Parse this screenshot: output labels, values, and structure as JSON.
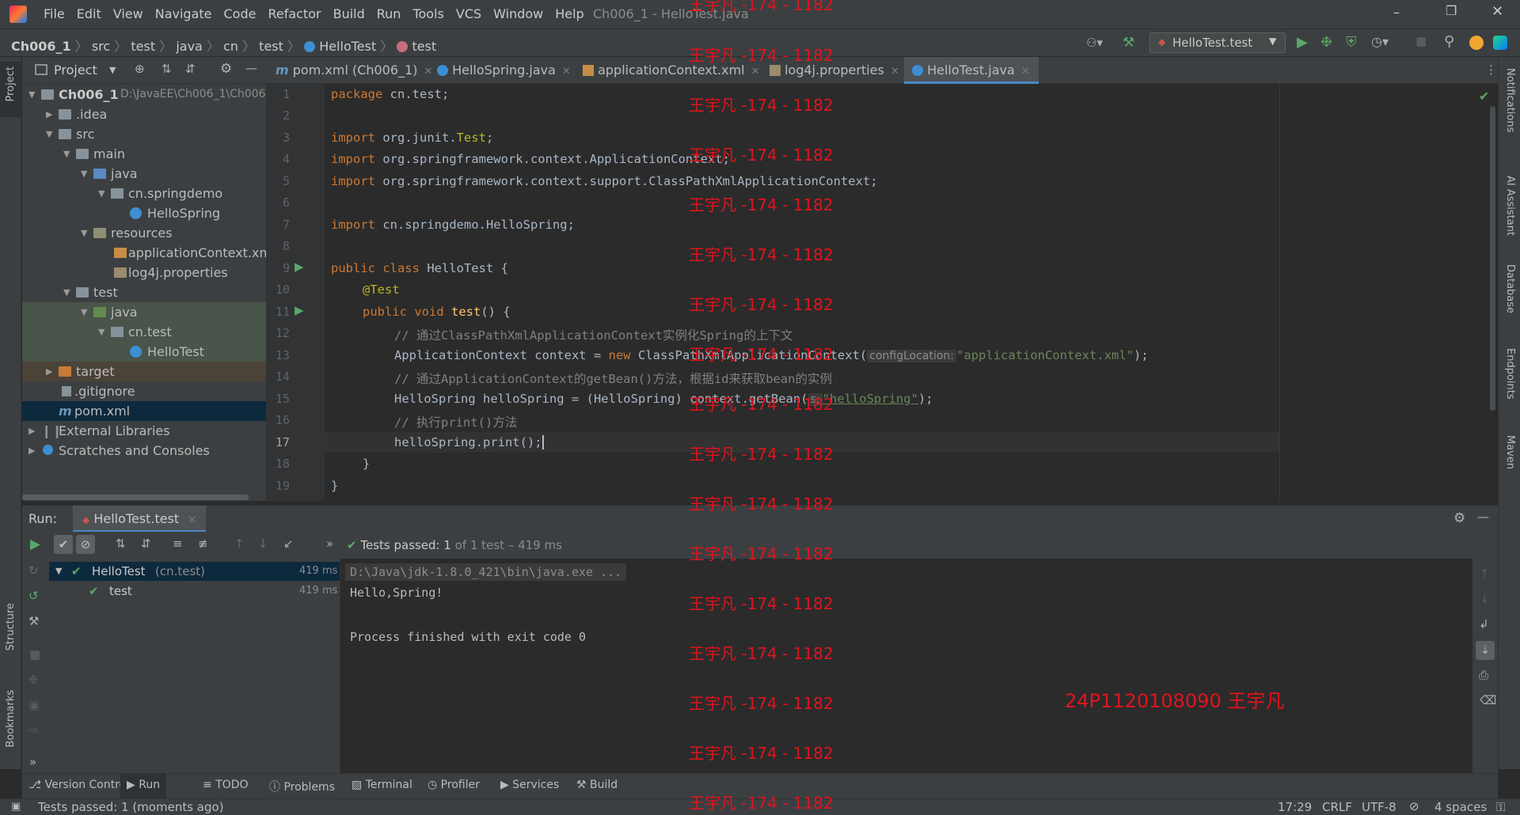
{
  "window": {
    "title": "Ch006_1 - HelloTest.java",
    "menu": [
      "File",
      "Edit",
      "View",
      "Navigate",
      "Code",
      "Refactor",
      "Build",
      "Run",
      "Tools",
      "VCS",
      "Window",
      "Help"
    ]
  },
  "breadcrumb": [
    "Ch006_1",
    "src",
    "test",
    "java",
    "cn",
    "test",
    "HelloTest",
    "test"
  ],
  "run_config": "HelloTest.test",
  "project_panel": {
    "title": "Project",
    "tree": [
      {
        "label": "Ch006_1",
        "extra": "D:\\JavaEE\\Ch006_1\\Ch006"
      },
      {
        "label": ".idea"
      },
      {
        "label": "src"
      },
      {
        "label": "main"
      },
      {
        "label": "java"
      },
      {
        "label": "cn.springdemo"
      },
      {
        "label": "HelloSpring"
      },
      {
        "label": "resources"
      },
      {
        "label": "applicationContext.xm"
      },
      {
        "label": "log4j.properties"
      },
      {
        "label": "test"
      },
      {
        "label": "java"
      },
      {
        "label": "cn.test"
      },
      {
        "label": "HelloTest"
      },
      {
        "label": "target"
      },
      {
        "label": ".gitignore"
      },
      {
        "label": "pom.xml"
      },
      {
        "label": "External Libraries"
      },
      {
        "label": "Scratches and Consoles"
      }
    ]
  },
  "editor_tabs": [
    "pom.xml (Ch006_1)",
    "HelloSpring.java",
    "applicationContext.xml",
    "log4j.properties",
    "HelloTest.java"
  ],
  "code": {
    "line_numbers": [
      "1",
      "2",
      "3",
      "4",
      "5",
      "6",
      "7",
      "8",
      "9",
      "10",
      "11",
      "12",
      "13",
      "14",
      "15",
      "16",
      "17",
      "18",
      "19"
    ],
    "l1": {
      "kw": "package",
      "rest": " cn.test;"
    },
    "l3": {
      "kw": "import",
      "rest": " org.junit.",
      "cls": "Test",
      ";": ";"
    },
    "l4": {
      "kw": "import",
      "rest": " org.springframework.context.ApplicationContext;"
    },
    "l5": {
      "kw": "import",
      "rest": " org.springframework.context.support.ClassPathXmlApplicationContext;"
    },
    "l7": {
      "kw": "import",
      "rest": " cn.springdemo.HelloSpring;"
    },
    "l9": {
      "kw": "public class",
      "rest": " HelloTest {"
    },
    "l10": {
      "ann": "@Test"
    },
    "l11": {
      "kw": "public void",
      "fn": "test",
      "rest": "() {"
    },
    "l12": {
      "cmt": "// 通过ClassPathXmlApplicationContext实例化Spring的上下文"
    },
    "l13": {
      "pre": "ApplicationContext context = ",
      "kw": "new",
      "mid": " ClassPathXmlApplicationContext(",
      "hint": "configLocation:",
      "str": "\"applicationContext.xml\"",
      "post": ");"
    },
    "l14": {
      "cmt": "// 通过ApplicationContext的getBean()方法，根据id来获取bean的实例"
    },
    "l15": {
      "pre": "HelloSpring helloSpring = (HelloSpring) context.getBean(",
      "hint": "s:",
      "str": "\"helloSpring\"",
      "post": ");"
    },
    "l16": {
      "cmt": "// 执行print()方法"
    },
    "l17": {
      "pre": "helloSpring.print();"
    },
    "l18": {
      "pre": "}"
    },
    "l19": {
      "pre": "}"
    }
  },
  "run_panel": {
    "label": "Run:",
    "tab": "HelloTest.test",
    "status": "Tests passed:",
    "status_count": "1",
    "status_detail": "of 1 test – 419 ms",
    "tree": [
      {
        "name": "HelloTest",
        "pkg": "(cn.test)",
        "time": "419 ms"
      },
      {
        "name": "test",
        "time": "419 ms"
      }
    ],
    "console": [
      "D:\\Java\\jdk-1.8.0_421\\bin\\java.exe ...",
      "Hello,Spring!",
      "",
      "Process finished with exit code 0"
    ]
  },
  "bottom_tabs": [
    "Version Control",
    "Run",
    "TODO",
    "Problems",
    "Terminal",
    "Profiler",
    "Services",
    "Build"
  ],
  "status_bar": {
    "message": "Tests passed: 1 (moments ago)",
    "position": "17:29",
    "line_sep": "CRLF",
    "encoding": "UTF-8",
    "indent": "4 spaces"
  },
  "right_stripe": [
    "Notifications",
    "AI Assistant",
    "Database",
    "Endpoints",
    "Maven"
  ],
  "left_stripe": [
    "Project",
    "Structure",
    "Bookmarks"
  ],
  "watermark": {
    "repeat": "王宇凡 -174 - 1182",
    "id": "24P1120108090 王宇凡"
  }
}
